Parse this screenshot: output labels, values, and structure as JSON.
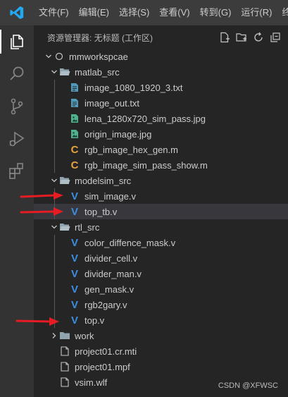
{
  "titlebar": {
    "menus": [
      "文件(F)",
      "编辑(E)",
      "选择(S)",
      "查看(V)",
      "转到(G)",
      "运行(R)",
      "终端"
    ]
  },
  "activity": {
    "items": [
      "explorer-icon",
      "search-icon",
      "source-control-icon",
      "run-debug-icon",
      "extensions-icon"
    ]
  },
  "sidebar": {
    "title": "资源管理器: 无标题 (工作区)",
    "actions": [
      "new-file-icon",
      "new-folder-icon",
      "refresh-icon",
      "collapse-all-icon"
    ]
  },
  "tree": {
    "root": "mmworkspcae",
    "matlab_src": {
      "label": "matlab_src",
      "files": [
        "image_1080_1920_3.txt",
        "image_out.txt",
        "lena_1280x720_sim_pass.jpg",
        "origin_image.jpg",
        "rgb_image_hex_gen.m",
        "rgb_image_sim_pass_show.m"
      ]
    },
    "modelsim_src": {
      "label": "modelsim_src",
      "files": [
        "sim_image.v",
        "top_tb.v"
      ]
    },
    "rtl_src": {
      "label": "rtl_src",
      "files": [
        "color_diffence_mask.v",
        "divider_cell.v",
        "divider_man.v",
        "gen_mask.v",
        "rgb2gary.v",
        "top.v"
      ]
    },
    "work": "work",
    "root_files": [
      "project01.cr.mti",
      "project01.mpf",
      "vsim.wlf"
    ]
  },
  "colors": {
    "verilog": "#3d8ee0",
    "text_file": "#519aba",
    "image_file": "#4fb38e",
    "matlab": "#e8a33d",
    "annotation_arrow": "#e51c23"
  },
  "watermark": "CSDN @XFWSC"
}
